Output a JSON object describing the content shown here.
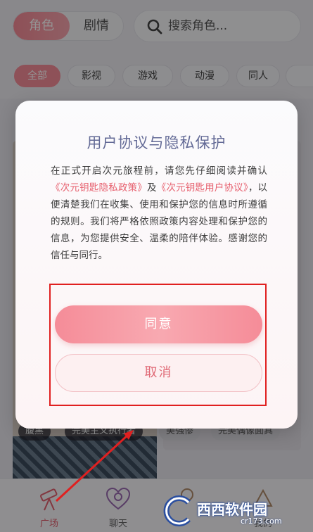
{
  "header": {
    "segment_active": "角色",
    "segment_inactive": "剧情",
    "search_placeholder": "搜索角色..."
  },
  "categories": [
    "全部",
    "影视",
    "游戏",
    "动漫",
    "同人"
  ],
  "cards": {
    "left_tag_1": "腹黑",
    "left_tag_2": "完美主义执行者",
    "right_tag_1": "美强惨",
    "right_tag_2": "完美偶像面具"
  },
  "nav": {
    "item1": "广场",
    "item2": "聊天",
    "item3": "",
    "item4": "我的"
  },
  "dialog": {
    "title": "用户协议与隐私保护",
    "body_pre": "在正式开启次元旅程前，请您先仔细阅读并确认",
    "privacy_link": "《次元钥匙隐私政策》",
    "and": "及",
    "user_link": "《次元钥匙用户协议》",
    "body_post": "，以便清楚我们在收集、使用和保护您的信息时所遵循的规则。我们将严格依照政策内容处理和保护您的信息，为您提供安全、温柔的陪伴体验。感谢您的信任与同行。",
    "agree_label": "同意",
    "cancel_label": "取消"
  },
  "watermark": {
    "brand": "西西软件园",
    "url": "cr173.com"
  },
  "colors": {
    "accent": "#f58c98",
    "link": "#e7606e",
    "title": "#636a96",
    "highlight_box": "#e02020"
  }
}
